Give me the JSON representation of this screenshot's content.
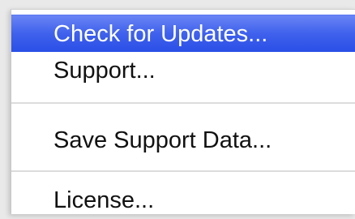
{
  "menu": {
    "items": [
      {
        "label": "Check for Updates...",
        "highlighted": true
      },
      {
        "label": "Support...",
        "highlighted": false
      },
      {
        "label": "Save Support Data...",
        "highlighted": false
      },
      {
        "label": "License...",
        "highlighted": false
      }
    ],
    "highlight_color": "#3f61ec",
    "text_color": "#111111",
    "highlight_text_color": "#ffffff"
  }
}
